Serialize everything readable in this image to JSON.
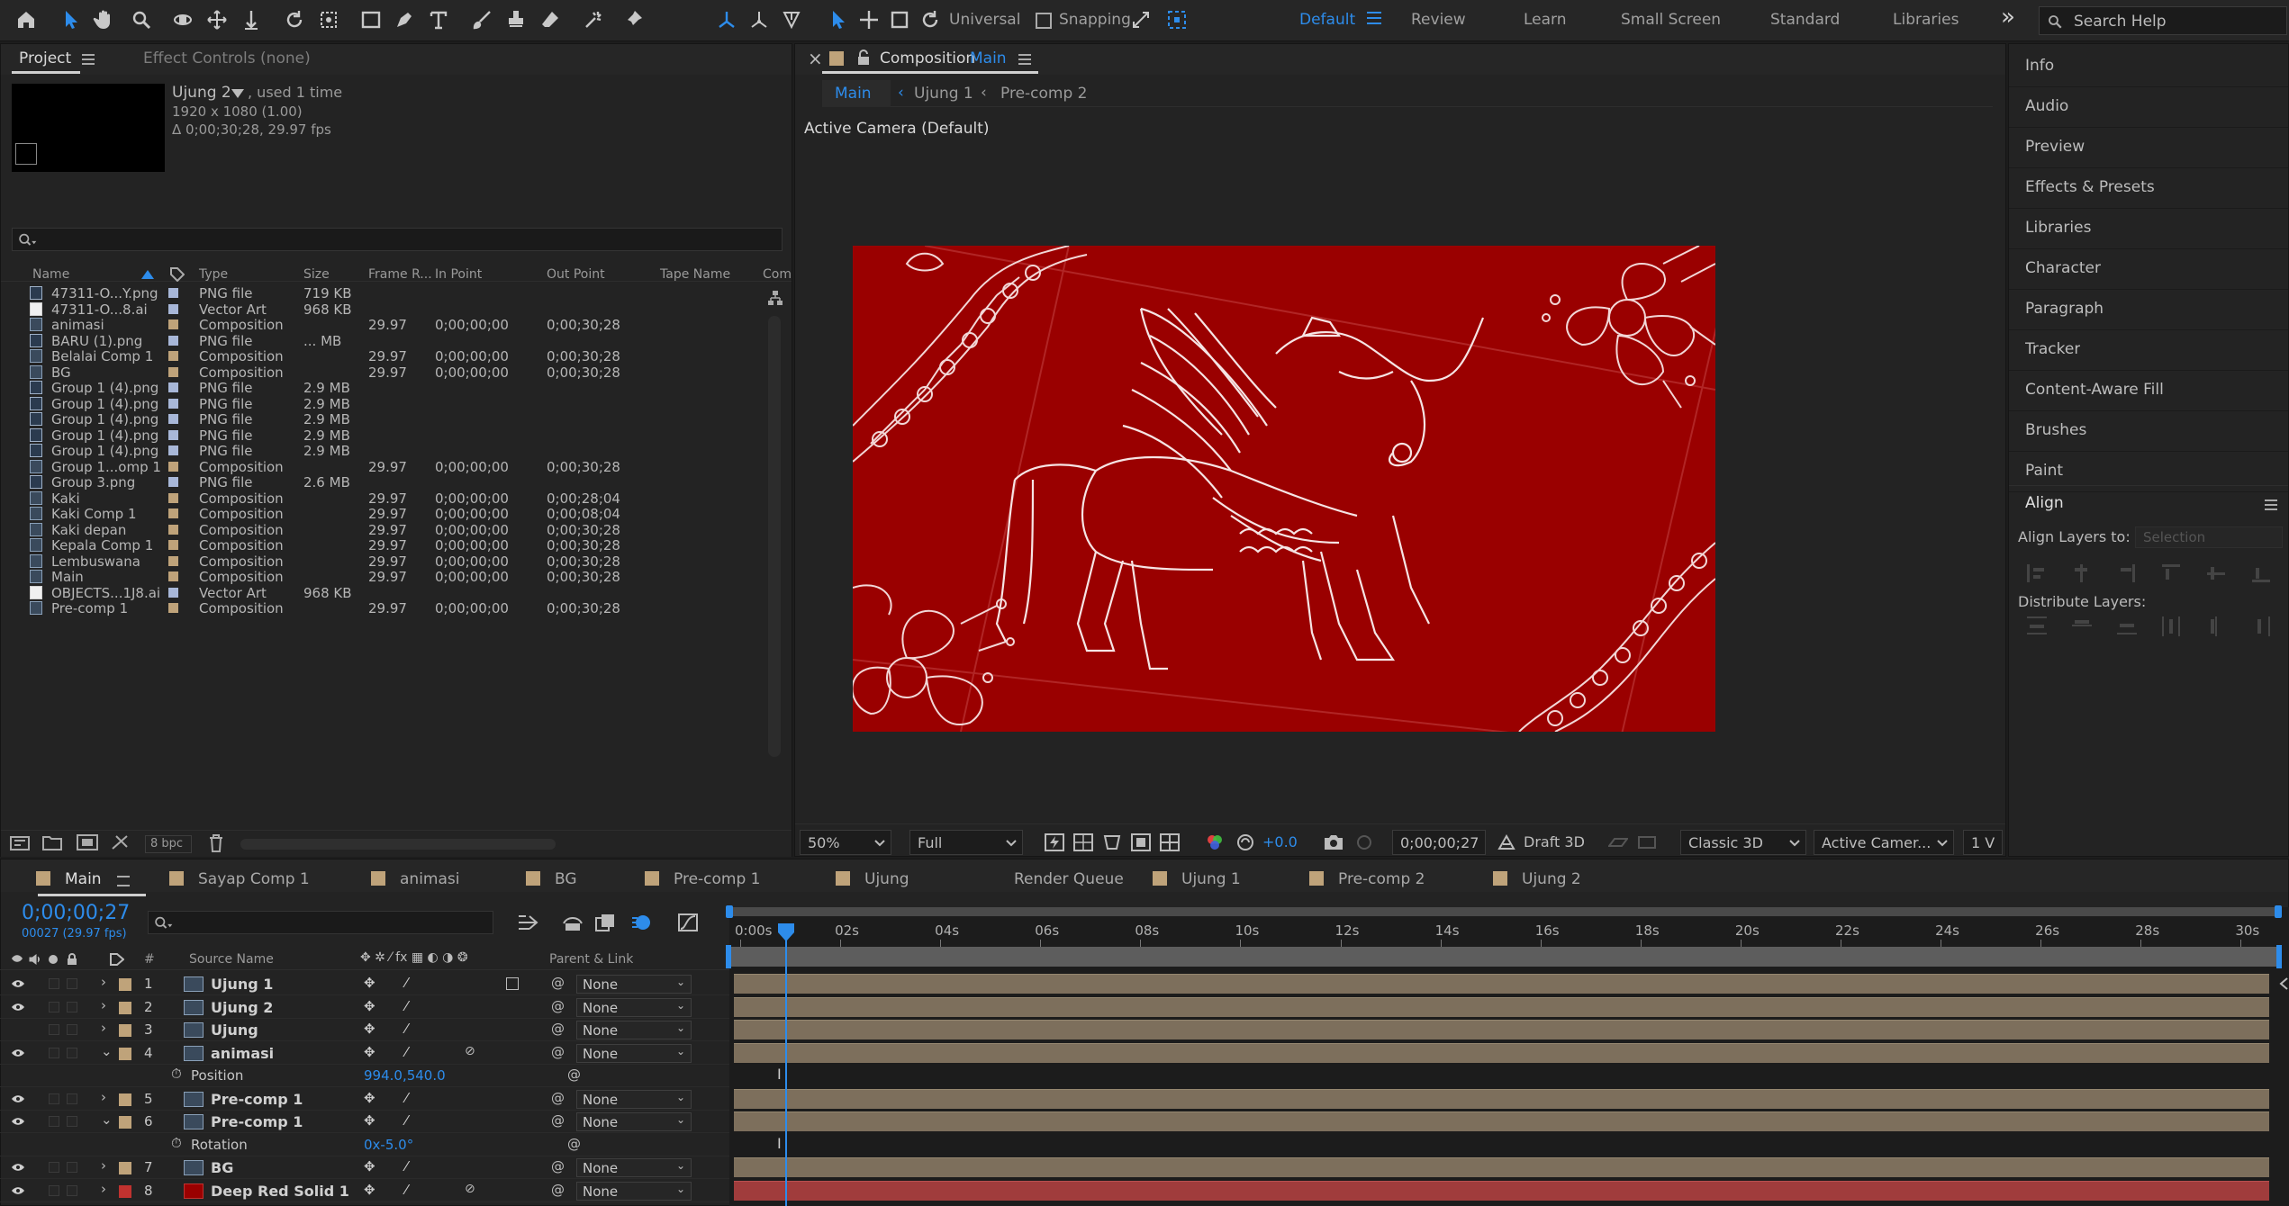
{
  "toolbar": {
    "workspace_universal": "Universal",
    "snapping": "Snapping",
    "workspaces": [
      "Default",
      "Review",
      "Learn",
      "Small Screen",
      "Standard",
      "Libraries"
    ],
    "more": "»",
    "search_placeholder": "Search Help"
  },
  "project": {
    "tab": "Project",
    "effect_controls": "Effect Controls (none)",
    "selected_name": "Ujung 2",
    "used": ", used 1 time",
    "dims": "1920 x 1080 (1.00)",
    "duration": "Δ 0;00;30;28, 29.97 fps",
    "columns": [
      "Name",
      "Type",
      "Size",
      "Frame R...",
      "In Point",
      "Out Point",
      "Tape Name",
      "Com"
    ],
    "rows": [
      {
        "name": "47311-O...Y.png",
        "type": "PNG file",
        "size": "719 KB",
        "fr": "",
        "in": "",
        "out": "",
        "icon": "png",
        "color": "#a8b7d8"
      },
      {
        "name": "47311-O...8.ai",
        "type": "Vector Art",
        "size": "968 KB",
        "fr": "",
        "in": "",
        "out": "",
        "icon": "doc",
        "color": "#a8b7d8"
      },
      {
        "name": "animasi",
        "type": "Composition",
        "size": "",
        "fr": "29.97",
        "in": "0;00;00;00",
        "out": "0;00;30;28",
        "icon": "comp",
        "color": "#bfa37a"
      },
      {
        "name": "BARU (1).png",
        "type": "PNG file",
        "size": "... MB",
        "fr": "",
        "in": "",
        "out": "",
        "icon": "png",
        "color": "#a8b7d8"
      },
      {
        "name": "Belalai Comp 1",
        "type": "Composition",
        "size": "",
        "fr": "29.97",
        "in": "0;00;00;00",
        "out": "0;00;30;28",
        "icon": "comp",
        "color": "#bfa37a"
      },
      {
        "name": "BG",
        "type": "Composition",
        "size": "",
        "fr": "29.97",
        "in": "0;00;00;00",
        "out": "0;00;30;28",
        "icon": "comp",
        "color": "#bfa37a"
      },
      {
        "name": "Group 1 (4).png",
        "type": "PNG file",
        "size": "2.9 MB",
        "fr": "",
        "in": "",
        "out": "",
        "icon": "png",
        "color": "#a8b7d8"
      },
      {
        "name": "Group 1 (4).png",
        "type": "PNG file",
        "size": "2.9 MB",
        "fr": "",
        "in": "",
        "out": "",
        "icon": "png",
        "color": "#a8b7d8"
      },
      {
        "name": "Group 1 (4).png",
        "type": "PNG file",
        "size": "2.9 MB",
        "fr": "",
        "in": "",
        "out": "",
        "icon": "png",
        "color": "#a8b7d8"
      },
      {
        "name": "Group 1 (4).png",
        "type": "PNG file",
        "size": "2.9 MB",
        "fr": "",
        "in": "",
        "out": "",
        "icon": "png",
        "color": "#a8b7d8"
      },
      {
        "name": "Group 1 (4).png",
        "type": "PNG file",
        "size": "2.9 MB",
        "fr": "",
        "in": "",
        "out": "",
        "icon": "png",
        "color": "#a8b7d8"
      },
      {
        "name": "Group 1...omp 1",
        "type": "Composition",
        "size": "",
        "fr": "29.97",
        "in": "0;00;00;00",
        "out": "0;00;30;28",
        "icon": "comp",
        "color": "#bfa37a"
      },
      {
        "name": "Group 3.png",
        "type": "PNG file",
        "size": "2.6 MB",
        "fr": "",
        "in": "",
        "out": "",
        "icon": "png",
        "color": "#a8b7d8"
      },
      {
        "name": "Kaki",
        "type": "Composition",
        "size": "",
        "fr": "29.97",
        "in": "0;00;00;00",
        "out": "0;00;28;04",
        "icon": "comp",
        "color": "#bfa37a"
      },
      {
        "name": "Kaki Comp 1",
        "type": "Composition",
        "size": "",
        "fr": "29.97",
        "in": "0;00;00;00",
        "out": "0;00;08;04",
        "icon": "comp",
        "color": "#bfa37a"
      },
      {
        "name": "Kaki depan",
        "type": "Composition",
        "size": "",
        "fr": "29.97",
        "in": "0;00;00;00",
        "out": "0;00;30;28",
        "icon": "comp",
        "color": "#bfa37a"
      },
      {
        "name": "Kepala Comp 1",
        "type": "Composition",
        "size": "",
        "fr": "29.97",
        "in": "0;00;00;00",
        "out": "0;00;30;28",
        "icon": "comp",
        "color": "#bfa37a"
      },
      {
        "name": "Lembuswana",
        "type": "Composition",
        "size": "",
        "fr": "29.97",
        "in": "0;00;00;00",
        "out": "0;00;30;28",
        "icon": "comp",
        "color": "#bfa37a"
      },
      {
        "name": "Main",
        "type": "Composition",
        "size": "",
        "fr": "29.97",
        "in": "0;00;00;00",
        "out": "0;00;30;28",
        "icon": "comp",
        "color": "#bfa37a"
      },
      {
        "name": "OBJECTS...1J8.ai",
        "type": "Vector Art",
        "size": "968 KB",
        "fr": "",
        "in": "",
        "out": "",
        "icon": "doc",
        "color": "#a8b7d8"
      },
      {
        "name": "Pre-comp 1",
        "type": "Composition",
        "size": "",
        "fr": "29.97",
        "in": "0;00;00;00",
        "out": "0;00;30;28",
        "icon": "comp",
        "color": "#bfa37a"
      }
    ],
    "bpc": "8 bpc"
  },
  "viewer": {
    "tab_label": "Composition",
    "tab_name": "Main",
    "crumbs": [
      "Main",
      "Ujung 1",
      "Pre-comp 2"
    ],
    "camera": "Active Camera (Default)",
    "zoom": "50%",
    "resolution": "Full",
    "exposure": "+0.0",
    "timecode": "0;00;00;27",
    "draft3d": "Draft 3D",
    "renderer": "Classic 3D",
    "view": "Active Camer...",
    "views": "1 V",
    "bg_color": "#9a0000"
  },
  "right_panels": {
    "items": [
      "Info",
      "Audio",
      "Preview",
      "Effects & Presets",
      "Libraries",
      "Character",
      "Paragraph",
      "Tracker",
      "Content-Aware Fill",
      "Brushes",
      "Paint"
    ],
    "align_title": "Align",
    "align_to_label": "Align Layers to:",
    "align_to_value": "Selection",
    "distribute_label": "Distribute Layers:"
  },
  "timeline": {
    "tabs": [
      "Main",
      "Sayap Comp 1",
      "animasi",
      "BG",
      "Pre-comp 1",
      "Ujung",
      "Render Queue",
      "Ujung 1",
      "Pre-comp 2",
      "Ujung 2"
    ],
    "timecode": "0;00;00;27",
    "frame_info": "00027 (29.97 fps)",
    "col_source": "Source Name",
    "col_parent": "Parent & Link",
    "col_num": "#",
    "ruler": [
      "0:00s",
      "02s",
      "04s",
      "06s",
      "08s",
      "10s",
      "12s",
      "14s",
      "16s",
      "18s",
      "20s",
      "22s",
      "24s",
      "26s",
      "28s",
      "30s"
    ],
    "playhead_seconds": 0.9,
    "duration_seconds": 30.93,
    "layers": [
      {
        "num": "1",
        "name": "Ujung 1",
        "parent": "None",
        "color": "#bfa37a",
        "type": "layer",
        "visible": true,
        "expanded": false
      },
      {
        "num": "2",
        "name": "Ujung 2",
        "parent": "None",
        "color": "#bfa37a",
        "type": "layer",
        "visible": true,
        "expanded": false
      },
      {
        "num": "3",
        "name": "Ujung",
        "parent": "None",
        "color": "#bfa37a",
        "type": "layer",
        "visible": false,
        "expanded": false
      },
      {
        "num": "4",
        "name": "animasi",
        "parent": "None",
        "color": "#bfa37a",
        "type": "layer",
        "visible": true,
        "expanded": true
      },
      {
        "num": "",
        "name": "Position",
        "value": "994.0,540.0",
        "type": "prop"
      },
      {
        "num": "5",
        "name": "Pre-comp 1",
        "parent": "None",
        "color": "#bfa37a",
        "type": "layer",
        "visible": true,
        "expanded": false
      },
      {
        "num": "6",
        "name": "Pre-comp 1",
        "parent": "None",
        "color": "#bfa37a",
        "type": "layer",
        "visible": true,
        "expanded": true
      },
      {
        "num": "",
        "name": "Rotation",
        "value": "0x-5.0°",
        "type": "prop"
      },
      {
        "num": "7",
        "name": "BG",
        "parent": "None",
        "color": "#bfa37a",
        "type": "layer",
        "visible": true,
        "expanded": false
      },
      {
        "num": "8",
        "name": "Deep Red Solid 1",
        "parent": "None",
        "color": "#c0322f",
        "type": "solid",
        "visible": true,
        "expanded": false
      }
    ]
  }
}
